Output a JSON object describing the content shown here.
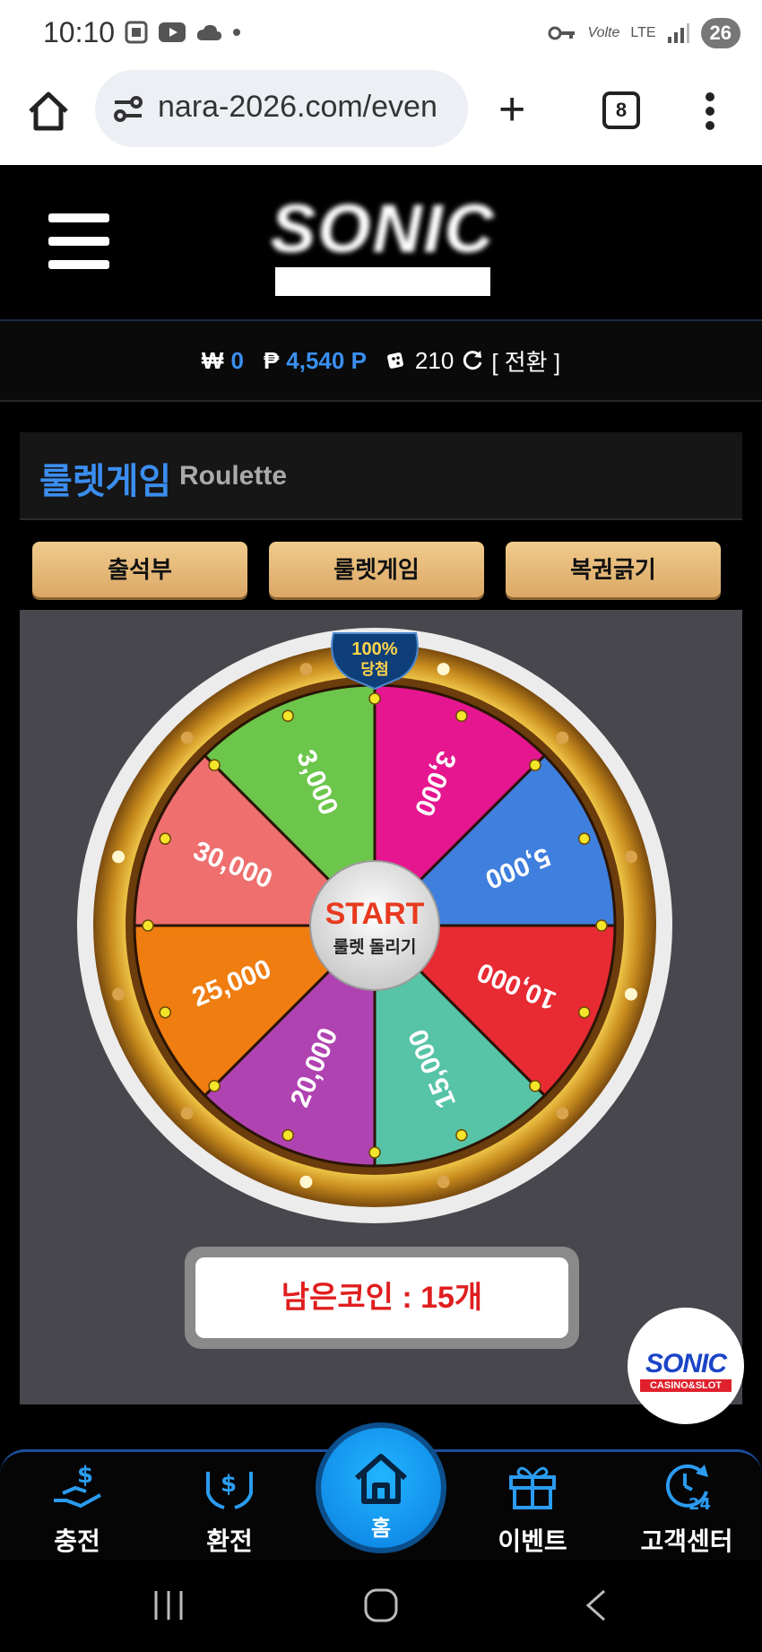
{
  "status_bar": {
    "time": "10:10",
    "network": "LTE",
    "volte": "Volte",
    "battery": "26"
  },
  "browser": {
    "url": "nara-2026.com/even",
    "tabs_count": "8"
  },
  "header": {
    "logo_text": "SONIC"
  },
  "balance": {
    "won_symbol": "₩",
    "won_value": "0",
    "point_symbol": "₱",
    "point_value": "4,540 P",
    "coin_value": "210",
    "switch_label": "[ 전환 ]"
  },
  "panel": {
    "title_kr": "룰렛게임",
    "title_en": "Roulette",
    "tabs": [
      {
        "label": "출석부"
      },
      {
        "label": "룰렛게임"
      },
      {
        "label": "복권긁기"
      }
    ]
  },
  "roulette": {
    "badge_percent": "100%",
    "badge_text": "당첨",
    "start_label": "START",
    "start_sub": "룰렛 돌리기",
    "segments": [
      {
        "label": "3,000",
        "color": "#e5168f"
      },
      {
        "label": "5,000",
        "color": "#3f7fdd"
      },
      {
        "label": "10,000",
        "color": "#e82a33"
      },
      {
        "label": "15,000",
        "color": "#57c3a7"
      },
      {
        "label": "20,000",
        "color": "#b043b2"
      },
      {
        "label": "25,000",
        "color": "#ef7d10"
      },
      {
        "label": "30,000",
        "color": "#ee6f6e"
      },
      {
        "label": "3,000",
        "color": "#6cc64b"
      }
    ],
    "coins_text": "남은코인 : 15개"
  },
  "floating_badge": {
    "title": "SONIC",
    "subtitle": "CASINO&SLOT"
  },
  "bottom_nav": {
    "charge": "충전",
    "exchange": "환전",
    "home": "홈",
    "event": "이벤트",
    "support": "고객센터"
  }
}
